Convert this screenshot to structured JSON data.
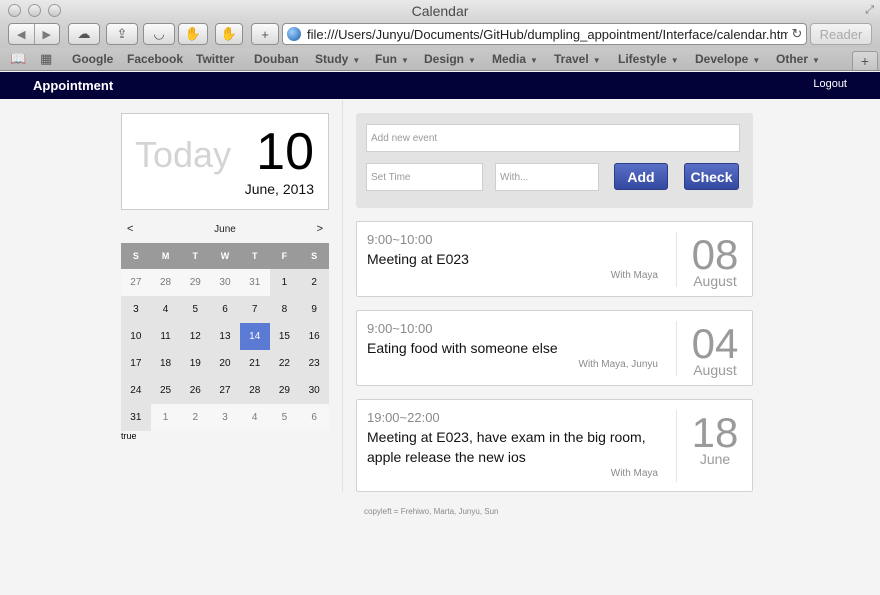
{
  "window": {
    "title": "Calendar"
  },
  "toolbar": {
    "url": "file:///Users/Junyu/Documents/GitHub/dumpling_appointment/Interface/calendar.html",
    "reader_label": "Reader"
  },
  "bookmarks": {
    "items": [
      {
        "label": "Google",
        "menu": false
      },
      {
        "label": "Facebook",
        "menu": false
      },
      {
        "label": "Twitter",
        "menu": false
      },
      {
        "label": "Douban",
        "menu": false
      },
      {
        "label": "Study",
        "menu": true
      },
      {
        "label": "Fun",
        "menu": true
      },
      {
        "label": "Design",
        "menu": true
      },
      {
        "label": "Media",
        "menu": true
      },
      {
        "label": "Travel",
        "menu": true
      },
      {
        "label": "Lifestyle",
        "menu": true
      },
      {
        "label": "Develope",
        "menu": true
      },
      {
        "label": "Other",
        "menu": true
      }
    ]
  },
  "app": {
    "brand": "Appointment",
    "logout_label": "Logout"
  },
  "today": {
    "word": "Today",
    "day": "10",
    "date": "June, 2013"
  },
  "calendar": {
    "prev": "<",
    "month": "June",
    "next": ">",
    "weekdays": [
      "S",
      "M",
      "T",
      "W",
      "T",
      "F",
      "S"
    ],
    "selected_day": "14",
    "weeks": [
      [
        {
          "d": "27",
          "m": "out"
        },
        {
          "d": "28",
          "m": "out"
        },
        {
          "d": "29",
          "m": "out"
        },
        {
          "d": "30",
          "m": "out"
        },
        {
          "d": "31",
          "m": "out"
        },
        {
          "d": "1",
          "m": "in"
        },
        {
          "d": "2",
          "m": "in"
        }
      ],
      [
        {
          "d": "3",
          "m": "in"
        },
        {
          "d": "4",
          "m": "in"
        },
        {
          "d": "5",
          "m": "in"
        },
        {
          "d": "6",
          "m": "in"
        },
        {
          "d": "7",
          "m": "in"
        },
        {
          "d": "8",
          "m": "in"
        },
        {
          "d": "9",
          "m": "in"
        }
      ],
      [
        {
          "d": "10",
          "m": "in"
        },
        {
          "d": "11",
          "m": "in"
        },
        {
          "d": "12",
          "m": "in"
        },
        {
          "d": "13",
          "m": "in"
        },
        {
          "d": "14",
          "m": "sel"
        },
        {
          "d": "15",
          "m": "in"
        },
        {
          "d": "16",
          "m": "in"
        }
      ],
      [
        {
          "d": "17",
          "m": "in"
        },
        {
          "d": "18",
          "m": "in"
        },
        {
          "d": "19",
          "m": "in"
        },
        {
          "d": "20",
          "m": "in"
        },
        {
          "d": "21",
          "m": "in"
        },
        {
          "d": "22",
          "m": "in"
        },
        {
          "d": "23",
          "m": "in"
        }
      ],
      [
        {
          "d": "24",
          "m": "in"
        },
        {
          "d": "25",
          "m": "in"
        },
        {
          "d": "26",
          "m": "in"
        },
        {
          "d": "27",
          "m": "in"
        },
        {
          "d": "28",
          "m": "in"
        },
        {
          "d": "29",
          "m": "in"
        },
        {
          "d": "30",
          "m": "in"
        }
      ],
      [
        {
          "d": "31",
          "m": "in"
        },
        {
          "d": "1",
          "m": "out"
        },
        {
          "d": "2",
          "m": "out"
        },
        {
          "d": "3",
          "m": "out"
        },
        {
          "d": "4",
          "m": "out"
        },
        {
          "d": "5",
          "m": "out"
        },
        {
          "d": "6",
          "m": "out"
        }
      ]
    ],
    "debug_text": "true"
  },
  "form": {
    "event_placeholder": "Add new event",
    "time_placeholder": "Set Time",
    "with_placeholder": "With...",
    "add_label": "Add",
    "check_label": "Check",
    "button_color": "#3f55b0"
  },
  "events": [
    {
      "time": "9:00~10:00",
      "title": "Meeting at E023",
      "with": "With Maya",
      "day": "08",
      "month": "August"
    },
    {
      "time": "9:00~10:00",
      "title": "Eating food with someone else",
      "with": "With Maya, Junyu",
      "day": "04",
      "month": "August"
    },
    {
      "time": "19:00~22:00",
      "title": "Meeting at E023, have exam in the big room, apple release the new ios",
      "with": "With Maya",
      "day": "18",
      "month": "June"
    }
  ],
  "footer": {
    "text": "copyleft = Frehiwo, Marta, Junyu, Sun"
  },
  "colors": {
    "appbar": "#020239",
    "selected_day": "#5b7ad4",
    "accent_button": "#3f55b0"
  }
}
